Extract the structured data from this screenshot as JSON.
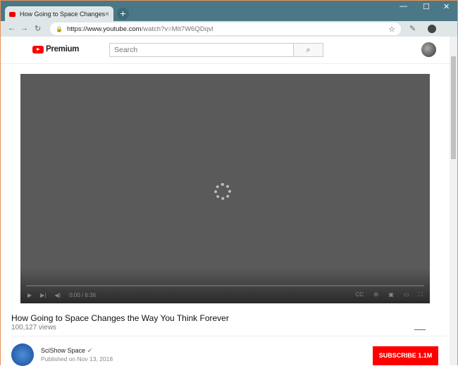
{
  "browser": {
    "tab_title": "How Going to Space Changes the Way You Think Forever",
    "new_tab": "+",
    "tab_close": "×",
    "minimize": "—",
    "maximize": "☐",
    "close": "✕",
    "url_host": "https://www.youtube.com",
    "url_path": "/watch?v=MIt7W6QDqvl",
    "star": "☆"
  },
  "youtube": {
    "logo_text": "Premium",
    "search_placeholder": "Search",
    "search_icon": "⌕"
  },
  "video": {
    "time": "0:00 / 6:36",
    "title": "How Going to Space Changes the Way You Think Forever",
    "views": "100,127 views"
  },
  "channel": {
    "name": "SciShow Space",
    "verified": "✔",
    "published": "Published on Nov 13, 2018",
    "subscribe": "SUBSCRIBE  1.1M"
  }
}
